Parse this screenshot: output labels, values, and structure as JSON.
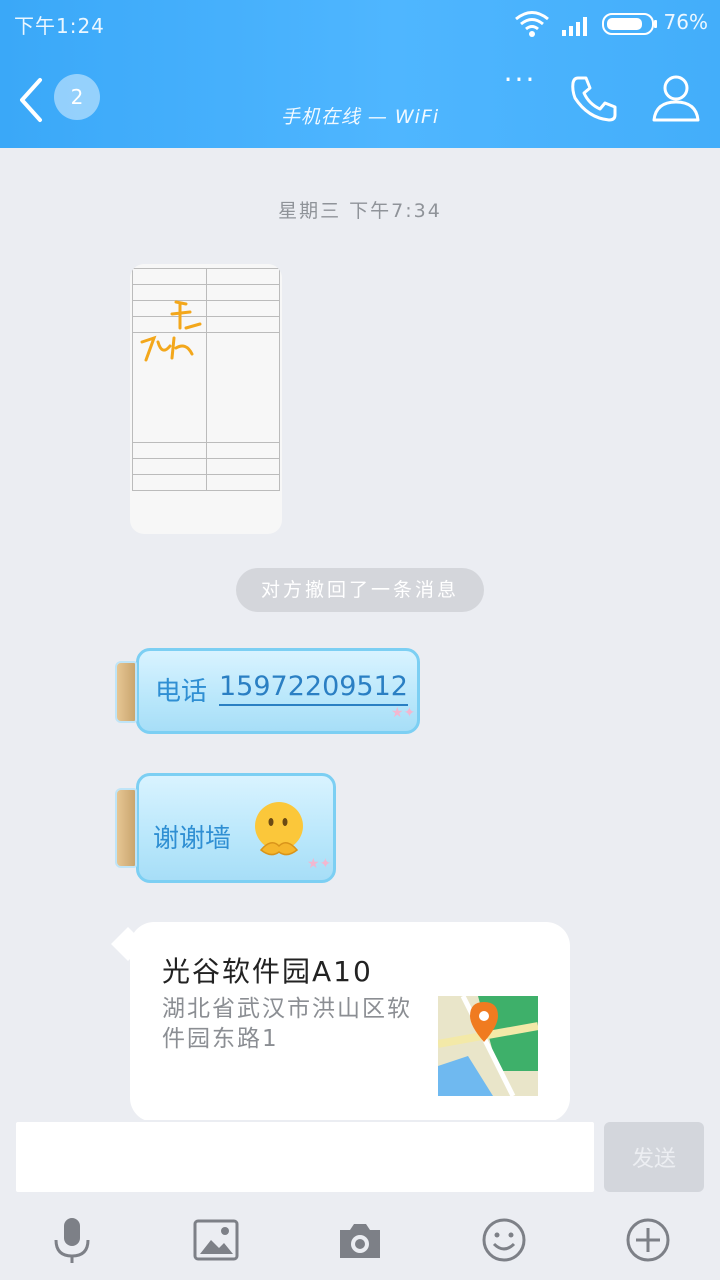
{
  "status_bar": {
    "time": "下午1:24",
    "battery": "76%"
  },
  "header": {
    "unread_count": "2",
    "subtitle": "手机在线 — WiFi",
    "more": "···"
  },
  "chat": {
    "timestamp": "星期三 下午7:34",
    "recall_notice": "对方撤回了一条消息",
    "phone_message": {
      "label": "电话",
      "number": "15972209512"
    },
    "thanks_message": {
      "text": "谢谢墙"
    },
    "location": {
      "title": "光谷软件园A10",
      "address": "湖北省武汉市洪山区软件园东路1"
    }
  },
  "input": {
    "placeholder": "",
    "send_label": "发送"
  },
  "colors": {
    "header": "#43aefa",
    "bubble_text": "#2f8fd3",
    "background": "#ebedf2",
    "map_pin": "#f07b20"
  },
  "icons": [
    "wifi-icon",
    "signal-icon",
    "battery-icon",
    "back-icon",
    "more-icon",
    "phone-icon",
    "person-icon",
    "microphone-icon",
    "image-icon",
    "camera-icon",
    "emoji-icon",
    "plus-icon"
  ]
}
